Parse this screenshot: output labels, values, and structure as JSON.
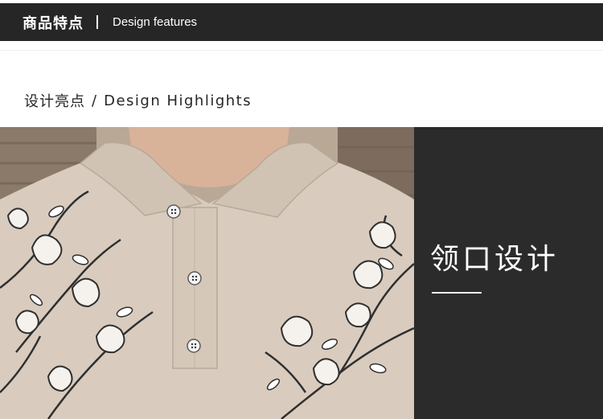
{
  "header": {
    "title_cn": "商品特点",
    "title_en": "Design features"
  },
  "subheading": {
    "cn": "设计亮点",
    "separator": "/",
    "en": "Design Highlights"
  },
  "feature": {
    "title": "领口设计"
  },
  "colors": {
    "header_bg": "#262626",
    "panel_bg": "#2b2b2b",
    "shirt": "#d9ccbe"
  }
}
